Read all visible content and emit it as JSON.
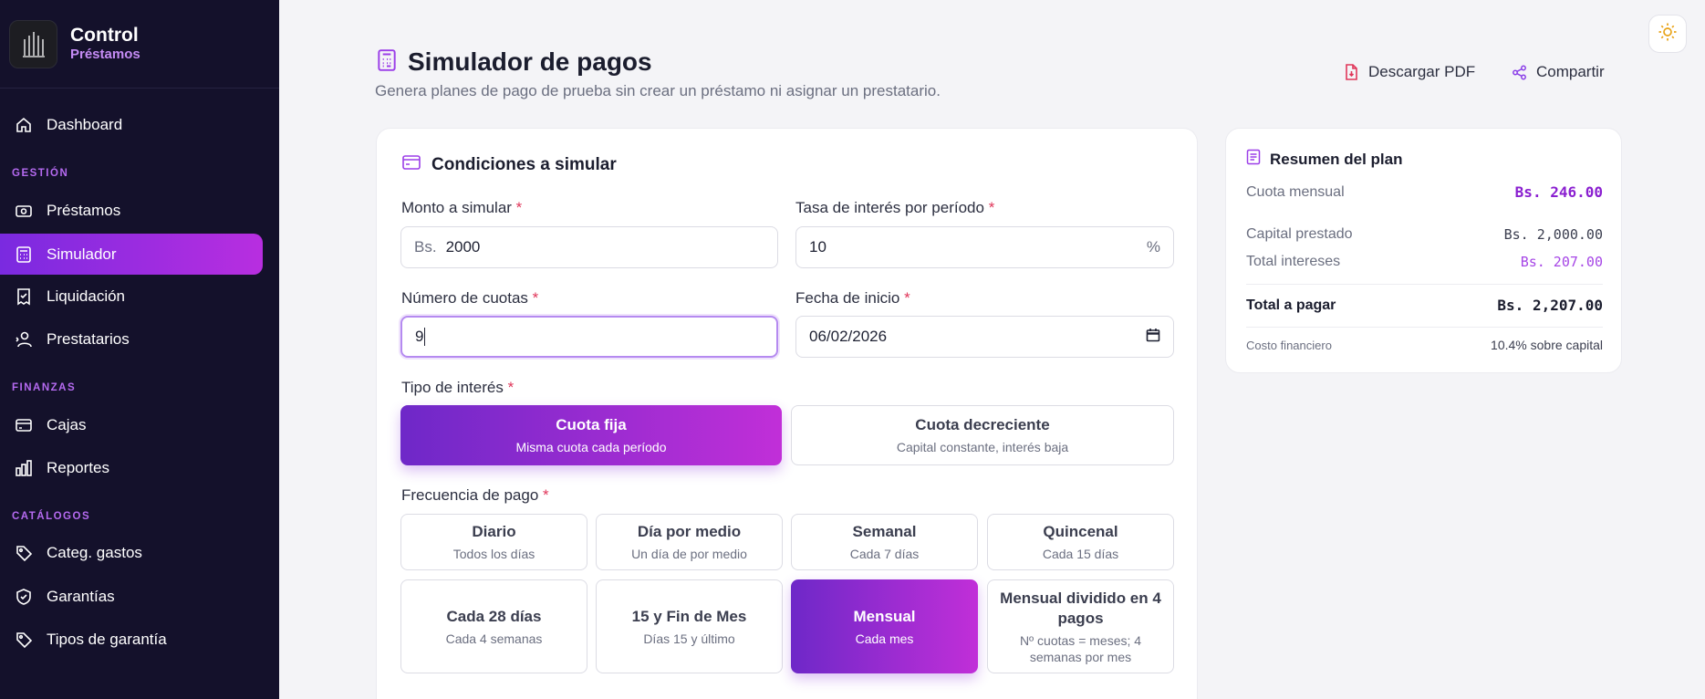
{
  "brand": {
    "title": "Control",
    "subtitle": "Préstamos"
  },
  "nav": {
    "dashboard": "Dashboard",
    "section_gestion": "GESTIÓN",
    "prestamos": "Préstamos",
    "simulador": "Simulador",
    "liquidacion": "Liquidación",
    "prestatarios": "Prestatarios",
    "section_finanzas": "FINANZAS",
    "cajas": "Cajas",
    "reportes": "Reportes",
    "section_catalogos": "CATÁLOGOS",
    "categ_gastos": "Categ. gastos",
    "garantias": "Garantías",
    "tipos_garantia": "Tipos de garantía"
  },
  "header": {
    "title": "Simulador de pagos",
    "description": "Genera planes de pago de prueba sin crear un préstamo ni asignar un prestatario.",
    "download_pdf": "Descargar PDF",
    "share": "Compartir"
  },
  "form": {
    "title": "Condiciones a simular",
    "monto_label": "Monto a simular",
    "monto_prefix": "Bs.",
    "monto_value": "2000",
    "tasa_label": "Tasa de interés por período",
    "tasa_value": "10",
    "tasa_suffix": "%",
    "cuotas_label": "Número de cuotas",
    "cuotas_value": "9",
    "fecha_label": "Fecha de inicio",
    "fecha_value": "06/02/2026",
    "required_mark": "*",
    "tipo_label": "Tipo de interés",
    "tipo_options": [
      {
        "title": "Cuota fija",
        "sub": "Misma cuota cada período",
        "selected": true
      },
      {
        "title": "Cuota decreciente",
        "sub": "Capital constante, interés baja",
        "selected": false
      }
    ],
    "frecuencia_label": "Frecuencia de pago",
    "frecuencia_options": [
      {
        "title": "Diario",
        "sub": "Todos los días",
        "selected": false
      },
      {
        "title": "Día por medio",
        "sub": "Un día de por medio",
        "selected": false
      },
      {
        "title": "Semanal",
        "sub": "Cada 7 días",
        "selected": false
      },
      {
        "title": "Quincenal",
        "sub": "Cada 15 días",
        "selected": false
      },
      {
        "title": "Cada 28 días",
        "sub": "Cada 4 semanas",
        "selected": false
      },
      {
        "title": "15 y Fin de Mes",
        "sub": "Días 15 y último",
        "selected": false
      },
      {
        "title": "Mensual",
        "sub": "Cada mes",
        "selected": true
      },
      {
        "title": "Mensual dividido en 4 pagos",
        "sub": "Nº cuotas = meses; 4 semanas por mes",
        "selected": false
      }
    ]
  },
  "summary": {
    "title": "Resumen del plan",
    "cuota_label": "Cuota mensual",
    "cuota_value": "Bs. 246.00",
    "capital_label": "Capital prestado",
    "capital_value": "Bs. 2,000.00",
    "intereses_label": "Total intereses",
    "intereses_value": "Bs. 207.00",
    "total_label": "Total a pagar",
    "total_value": "Bs. 2,207.00",
    "costo_label": "Costo financiero",
    "costo_value": "10.4% sobre capital"
  },
  "colors": {
    "accent_purple": "#7a2ae0",
    "accent_magenta": "#c12fd8",
    "sidebar_bg": "#14112b",
    "required_red": "#e0365a",
    "pdf_red": "#e0365a"
  }
}
